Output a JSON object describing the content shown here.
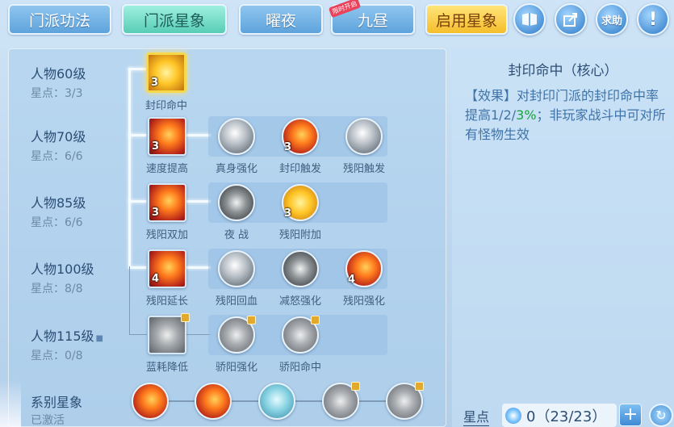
{
  "tabs": [
    {
      "label": "门派功法"
    },
    {
      "label": "门派星象"
    },
    {
      "label": "曜夜"
    },
    {
      "label": "九昼",
      "badge": "限时开启"
    },
    {
      "label": "启用星象"
    }
  ],
  "buttons": {
    "help": "求助",
    "alert": "!"
  },
  "levels": [
    {
      "title": "人物60级",
      "points": "星点：3/3"
    },
    {
      "title": "人物70级",
      "points": "星点：6/6"
    },
    {
      "title": "人物85级",
      "points": "星点：6/6"
    },
    {
      "title": "人物100级",
      "points": "星点：8/8"
    },
    {
      "title": "人物115级",
      "points": "星点：0/8"
    }
  ],
  "skills": {
    "r1": [
      {
        "label": "封印命中",
        "rank": "3"
      }
    ],
    "r2": [
      {
        "label": "速度提高",
        "rank": "3"
      },
      {
        "label": "真身强化",
        "rank": ""
      },
      {
        "label": "封印触发",
        "rank": "3"
      },
      {
        "label": "残阳触发",
        "rank": ""
      }
    ],
    "r3": [
      {
        "label": "残阳双加",
        "rank": "3"
      },
      {
        "label": "夜 战",
        "rank": ""
      },
      {
        "label": "残阳附加",
        "rank": "3"
      }
    ],
    "r4": [
      {
        "label": "残阳延长",
        "rank": "4"
      },
      {
        "label": "残阳回血",
        "rank": ""
      },
      {
        "label": "减怒强化",
        "rank": ""
      },
      {
        "label": "残阳强化",
        "rank": "4"
      }
    ],
    "r5": [
      {
        "label": "蓝耗降低"
      },
      {
        "label": "骄阳强化"
      },
      {
        "label": "骄阳命中"
      }
    ]
  },
  "faction": {
    "title": "系别星象",
    "status": "已激活"
  },
  "detail": {
    "title": "封印命中（核心）",
    "desc_pre": "【效果】对封印门派的封印命中率提高1/2/",
    "desc_hl": "3%",
    "desc_post": "；非玩家战斗中可对所有怪物生效"
  },
  "star_points": {
    "label": "星点",
    "value": "0（23/23）"
  }
}
